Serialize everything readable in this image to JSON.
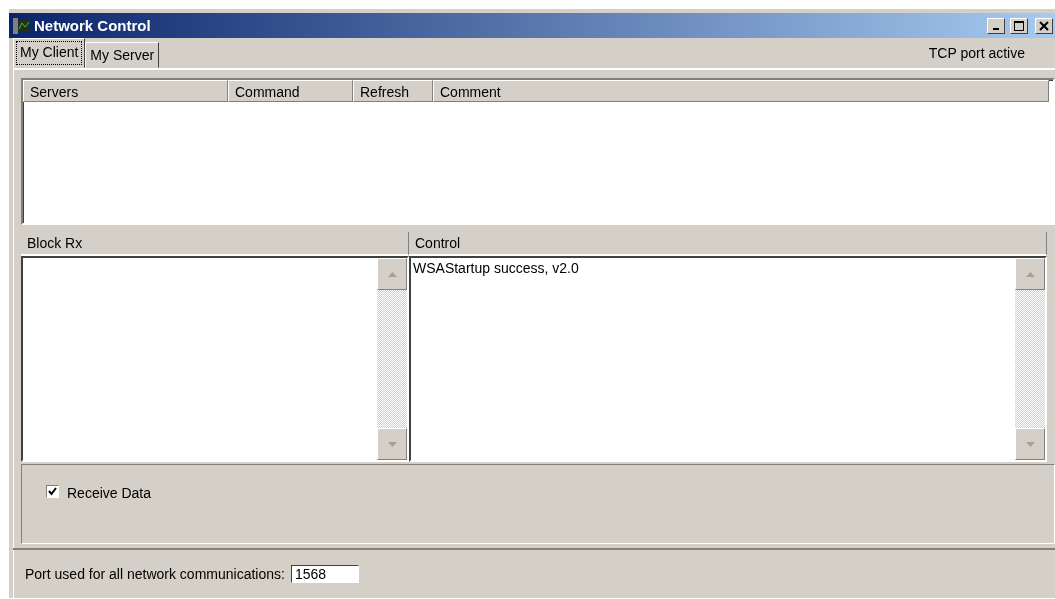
{
  "window": {
    "title": "Network Control"
  },
  "tabs": [
    {
      "label": "My Client",
      "selected": true
    },
    {
      "label": "My Server",
      "selected": false
    }
  ],
  "status_text": "TCP port active",
  "servers_table": {
    "columns": [
      "Servers",
      "Command",
      "Refresh",
      "Comment"
    ]
  },
  "block_rx": {
    "title": "Block Rx"
  },
  "control": {
    "title": "Control",
    "lines": [
      "WSAStartup success, v2.0"
    ]
  },
  "receive_data": {
    "label": "Receive Data",
    "checked": true
  },
  "port": {
    "label": "Port used for all network communications:",
    "value": "1568"
  }
}
